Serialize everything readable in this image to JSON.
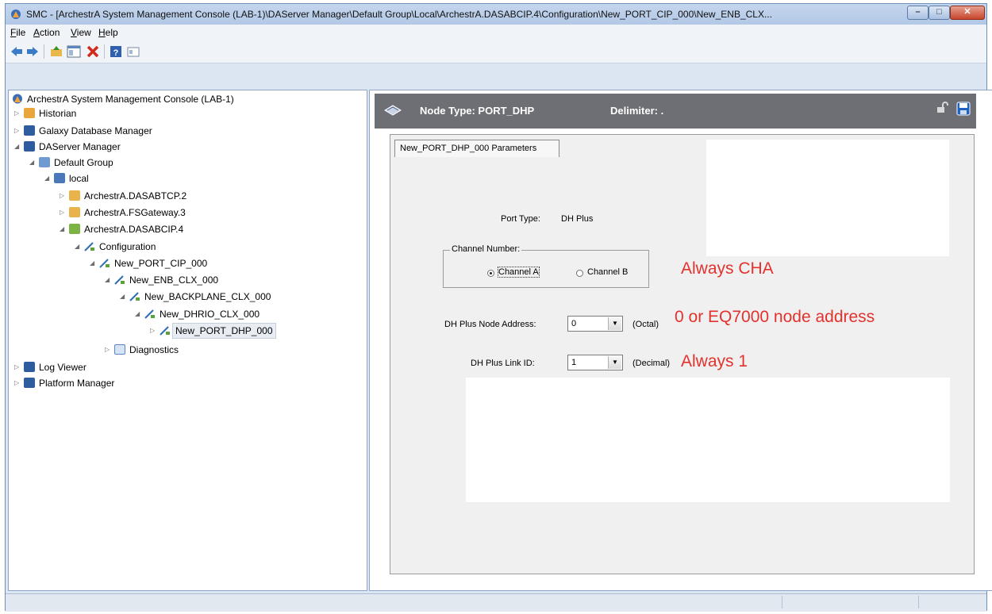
{
  "window": {
    "title": "SMC - [ArchestrA System Management Console (LAB-1)\\DAServer Manager\\Default Group\\Local\\ArchestrA.DASABCIP.4\\Configuration\\New_PORT_CIP_000\\New_ENB_CLX..."
  },
  "menu": {
    "file": "File",
    "action": "Action",
    "view": "View",
    "help": "Help"
  },
  "tree": {
    "root": "ArchestrA System Management Console (LAB-1)",
    "historian": "Historian",
    "galaxy_db_manager": "Galaxy Database Manager",
    "daserver_manager": "DAServer Manager",
    "default_group": "Default Group",
    "local": "local",
    "dasabtcp": "ArchestrA.DASABTCP.2",
    "fsgateway": "ArchestrA.FSGateway.3",
    "dasabcip": "ArchestrA.DASABCIP.4",
    "configuration": "Configuration",
    "port_cip": "New_PORT_CIP_000",
    "enb_clx": "New_ENB_CLX_000",
    "backplane_clx": "New_BACKPLANE_CLX_000",
    "dhrio_clx": "New_DHRIO_CLX_000",
    "port_dhp": "New_PORT_DHP_000",
    "diagnostics": "Diagnostics",
    "log_viewer": "Log Viewer",
    "platform_manager": "Platform Manager"
  },
  "node_header": {
    "node_type": "Node Type: PORT_DHP",
    "delimiter": "Delimiter:  ."
  },
  "params": {
    "tab_label": "New_PORT_DHP_000 Parameters",
    "port_type_label": "Port Type:",
    "port_type_value": "DH Plus",
    "channel_group_label": "Channel Number:",
    "channel_a": "Channel A",
    "channel_b": "Channel B",
    "channel_selected": "Channel A",
    "node_address_label": "DH Plus Node Address:",
    "node_address_value": "0",
    "node_address_unit": "(Octal)",
    "link_id_label": "DH Plus Link ID:",
    "link_id_value": "1",
    "link_id_unit": "(Decimal)"
  },
  "annotations": {
    "channel_note": "Always CHA",
    "node_address_note": "0 or EQ7000 node address",
    "link_id_note": "Always 1"
  },
  "colors": {
    "annotation": "#e3322d",
    "header_bg": "#6d6f74",
    "window_frame": "#dce6f2"
  },
  "icons": {
    "app": "smc-app-icon",
    "back": "back-arrow-icon",
    "forward": "forward-arrow-icon",
    "up": "up-folder-icon",
    "show_hide": "console-tree-icon",
    "delete": "delete-x-icon",
    "help": "help-icon",
    "properties": "properties-icon",
    "node": "port-node-icon",
    "lock": "lock-icon",
    "save": "save-icon"
  }
}
